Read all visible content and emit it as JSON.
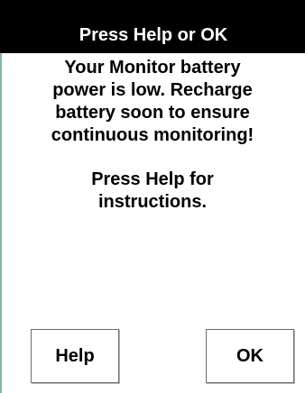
{
  "dialog": {
    "title": "Press Help or OK",
    "message_lines": [
      "Your Monitor battery",
      "power is low. Recharge",
      "battery soon to ensure",
      "continuous monitoring!"
    ],
    "instruction_lines": [
      "Press Help for",
      "instructions."
    ]
  },
  "buttons": {
    "help_label": "Help",
    "ok_label": "OK"
  }
}
